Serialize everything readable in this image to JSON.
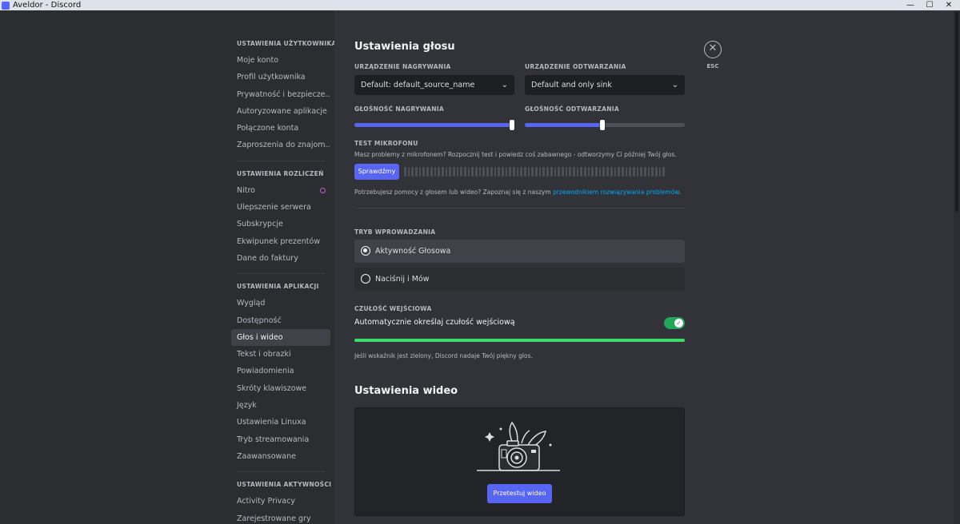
{
  "window": {
    "title": "Aveldor - Discord",
    "controls": [
      "—",
      "☐",
      "✕"
    ]
  },
  "sidebar": {
    "sections": [
      {
        "header": "USTAWIENIA UŻYTKOWNIKA",
        "items": [
          "Moje konto",
          "Profil użytkownika",
          "Prywatność i bezpiecze...",
          "Autoryzowane aplikacje",
          "Połączone konta",
          "Zaproszenia do znajom..."
        ]
      },
      {
        "header": "USTAWIENIA ROZLICZEŃ",
        "items": [
          "Nitro",
          "Ulepszenie serwera",
          "Subskrypcje",
          "Ekwipunek prezentów",
          "Dane do faktury"
        ]
      },
      {
        "header": "USTAWIENIA APLIKACJI",
        "items": [
          "Wygląd",
          "Dostępność",
          "Głos i wideo",
          "Tekst i obrazki",
          "Powiadomienia",
          "Skróty klawiszowe",
          "Język",
          "Ustawienia Linuxa",
          "Tryb streamowania",
          "Zaawansowane"
        ]
      },
      {
        "header": "USTAWIENIA AKTYWNOŚCI",
        "items": [
          "Activity Privacy",
          "Zarejestrowane gry"
        ]
      }
    ],
    "active": "Głos i wideo"
  },
  "voice": {
    "title": "Ustawienia głosu",
    "input_device_label": "URZĄDZENIE NAGRYWANIA",
    "input_device_value": "Default: default_source_name",
    "output_device_label": "URZĄDZENIE ODTWARZANIA",
    "output_device_value": "Default and only sink",
    "input_volume_label": "GŁOŚNOŚĆ NAGRYWANIA",
    "input_volume": 1.0,
    "output_volume_label": "GŁOŚNOŚĆ ODTWARZANIA",
    "output_volume": 0.5,
    "mic_test_label": "TEST MIKROFONU",
    "mic_test_desc": "Masz problemy z mikrofonem? Rozpocznij test i powiedz coś zabawnego - odtworzymy Ci później Twój głos.",
    "mic_test_button": "Sprawdźmy",
    "help_prefix": "Potrzebujesz pomocy z głosem lub wideo? Zapoznaj się z naszym ",
    "help_link": "przewodnikiem rozwiązywania problemów",
    "help_suffix": ".",
    "input_mode_label": "TRYB WPROWADZANIA",
    "input_mode_options": [
      "Aktywność Głosowa",
      "Naciśnij i Mów"
    ],
    "input_mode_selected": "Aktywność Głosowa",
    "sensitivity_label": "CZUŁOŚĆ WEJŚCIOWA",
    "sensitivity_auto_label": "Automatycznie określaj czułość wejściową",
    "sensitivity_auto_enabled": true,
    "sensitivity_note": "Jeśli wskaźnik jest zielony, Discord nadaje Twój piękny głos."
  },
  "video": {
    "title": "Ustawienia wideo",
    "test_button": "Przetestuj wideo"
  },
  "close": {
    "icon": "close-icon",
    "label": "ESC"
  },
  "colors": {
    "accent": "#5865f2",
    "green": "#23a55a",
    "link": "#00a8fc"
  }
}
